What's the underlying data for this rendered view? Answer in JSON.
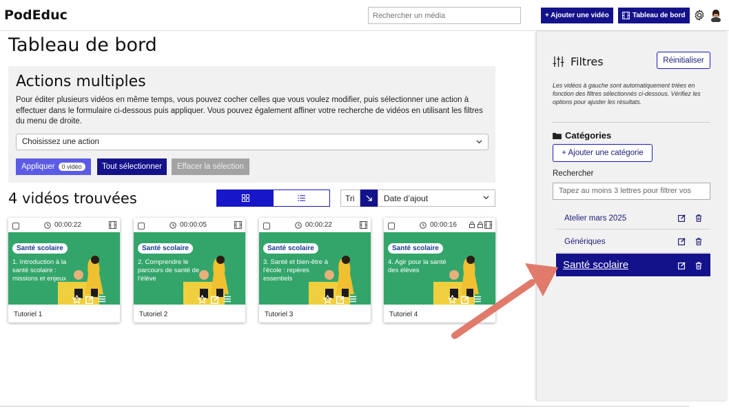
{
  "header": {
    "logo": "PodEduc",
    "search_placeholder": "Rechercher un média",
    "add_video_label": "+ Ajouter une vidéo",
    "dashboard_label": "Tableau de bord",
    "gear_icon": "gear-icon",
    "avatar_icon": "user-avatar"
  },
  "main": {
    "title": "Tableau de bord",
    "bulk_actions": {
      "title": "Actions multiples",
      "description": "Pour éditer plusieurs vidéos en même temps, vous pouvez cocher celles que vous voulez modifier, puis sélectionner une action à effectuer dans le formulaire ci-dessous puis appliquer. Vous pouvez également affiner votre recherche de vidéos en utilisant les filtres du menu de droite.",
      "select_value": "Choisissez une action",
      "apply_label": "Appliquer",
      "apply_badge": "0 vidéo",
      "select_all_label": "Tout sélectionner",
      "clear_label": "Effacer la sélection"
    },
    "results_count": "4 vidéos trouvées",
    "sort_label": "Tri",
    "sort_value": "Date d’ajout",
    "videos": [
      {
        "duration": "00:00:22",
        "category": "Santé scolaire",
        "thumb_text": "1. Introduction à la santé scolaire : missions et enjeux",
        "name": "Tutoriel 1"
      },
      {
        "duration": "00:00:05",
        "category": "Santé scolaire",
        "thumb_text": "2. Comprendre le parcours de santé de l'élève",
        "name": "Tutoriel 2"
      },
      {
        "duration": "00:00:22",
        "category": "Santé scolaire",
        "thumb_text": "3. Santé et bien-être à l'école : repères essentiels",
        "name": "Tutoriel 3"
      },
      {
        "duration": "00:00:16",
        "category": "Santé scolaire",
        "thumb_text": "4. Agir pour la santé des élèves",
        "name": "Tutoriel 4"
      }
    ]
  },
  "sidebar": {
    "filters_title": "Filtres",
    "reset_label": "Réinitialiser",
    "note": "Les vidéos à gauche sont automatiquement triées en fonction des filtres sélectionnés ci-dessous. Vérifiez les options pour ajuster les résultats.",
    "categories_title": "Catégories",
    "add_category_label": "+ Ajouter une catégorie",
    "search_label": "Rechercher",
    "search_placeholder": "Tapez au moins 3 lettres pour filtrer vos",
    "categories": [
      {
        "label": "Atelier mars 2025"
      },
      {
        "label": "Génériques"
      },
      {
        "label": "Santé scolaire",
        "active": true
      }
    ]
  },
  "colors": {
    "navy": "#14128a",
    "accent_blue": "#1717c9",
    "thumb_green": "#33a56b",
    "annotation_arrow": "#e07a6a"
  }
}
